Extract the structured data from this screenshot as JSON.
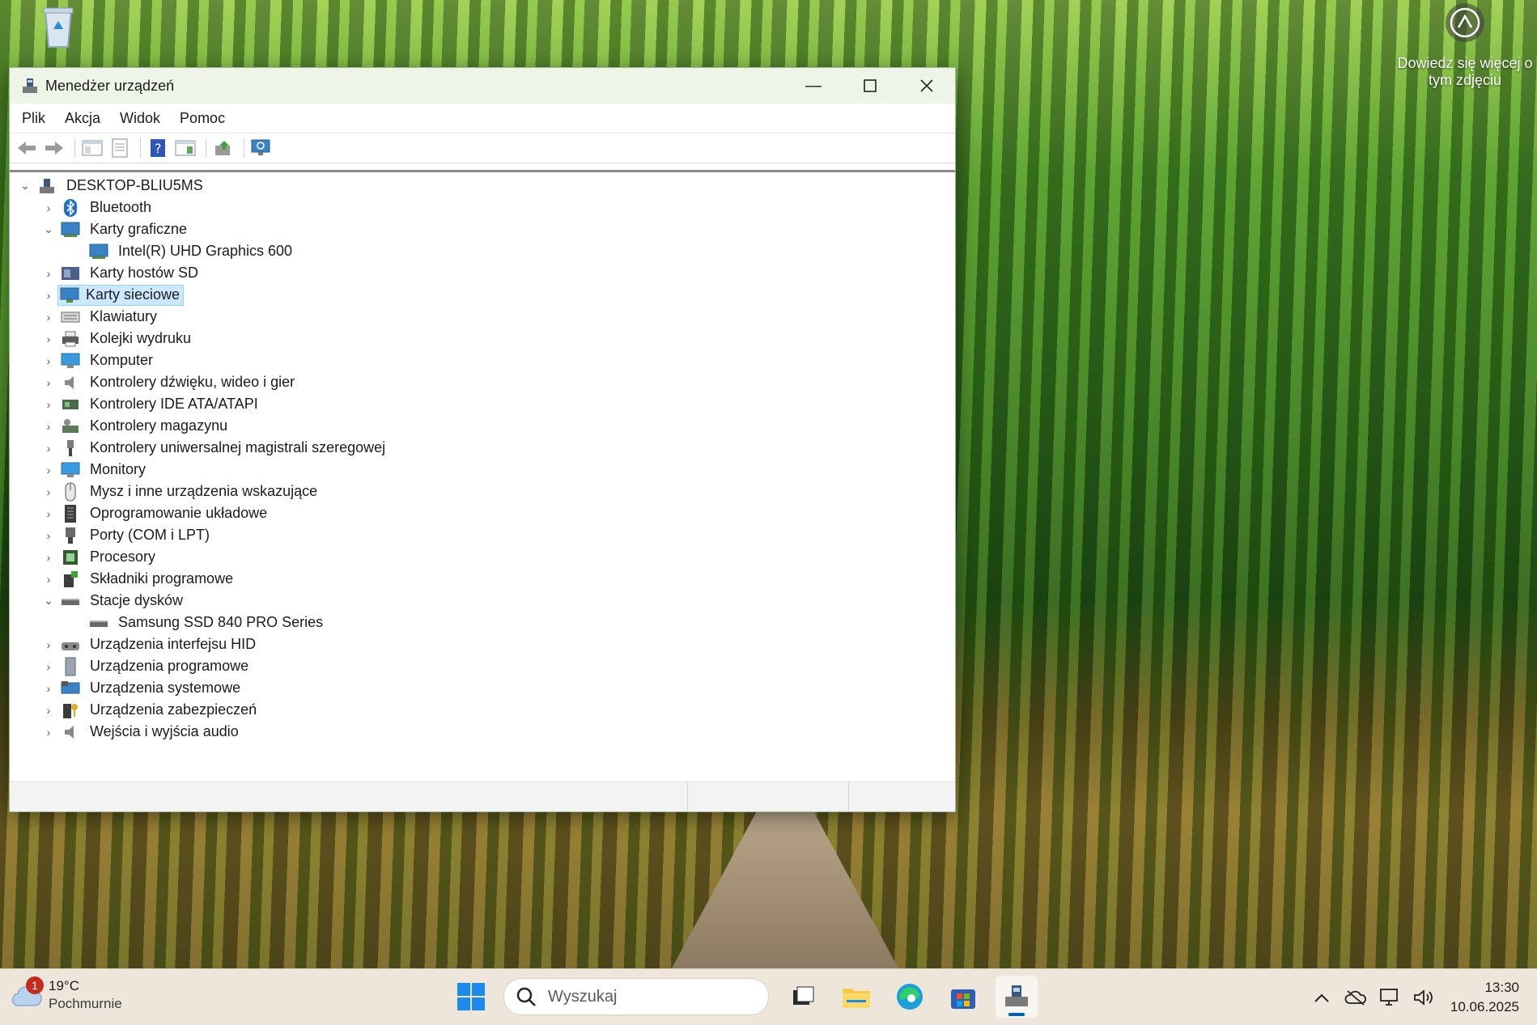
{
  "desktop": {
    "photo_info_text": "Dowiedz się więcej o tym zdjęciu"
  },
  "window": {
    "title": "Menedżer urządzeń",
    "menu": [
      "Plik",
      "Akcja",
      "Widok",
      "Pomoc"
    ],
    "toolbar_icons": [
      "back-arrow-icon",
      "forward-arrow-icon",
      "show-hide-console-tree-icon",
      "properties-icon",
      "help-icon",
      "action-pane-icon",
      "update-driver-icon",
      "scan-hardware-icon"
    ],
    "tree": {
      "root": "DESKTOP-BLIU5MS",
      "items": [
        {
          "label": "Bluetooth",
          "expanded": false,
          "icon": "bluetooth-icon"
        },
        {
          "label": "Karty graficzne",
          "expanded": true,
          "icon": "display-adapter-icon",
          "children": [
            "Intel(R) UHD Graphics 600"
          ]
        },
        {
          "label": "Karty hostów SD",
          "expanded": false,
          "icon": "sd-host-icon"
        },
        {
          "label": "Karty sieciowe",
          "expanded": false,
          "icon": "network-adapter-icon",
          "selected": true
        },
        {
          "label": "Klawiatury",
          "expanded": false,
          "icon": "keyboard-icon"
        },
        {
          "label": "Kolejki wydruku",
          "expanded": false,
          "icon": "printer-icon"
        },
        {
          "label": "Komputer",
          "expanded": false,
          "icon": "computer-icon"
        },
        {
          "label": "Kontrolery dźwięku, wideo i gier",
          "expanded": false,
          "icon": "speaker-icon"
        },
        {
          "label": "Kontrolery IDE ATA/ATAPI",
          "expanded": false,
          "icon": "ide-controller-icon"
        },
        {
          "label": "Kontrolery magazynu",
          "expanded": false,
          "icon": "storage-controller-icon"
        },
        {
          "label": "Kontrolery uniwersalnej magistrali szeregowej",
          "expanded": false,
          "icon": "usb-icon"
        },
        {
          "label": "Monitory",
          "expanded": false,
          "icon": "monitor-icon"
        },
        {
          "label": "Mysz i inne urządzenia wskazujące",
          "expanded": false,
          "icon": "mouse-icon"
        },
        {
          "label": "Oprogramowanie układowe",
          "expanded": false,
          "icon": "firmware-icon"
        },
        {
          "label": "Porty (COM i LPT)",
          "expanded": false,
          "icon": "port-icon"
        },
        {
          "label": "Procesory",
          "expanded": false,
          "icon": "processor-icon"
        },
        {
          "label": "Składniki programowe",
          "expanded": false,
          "icon": "software-component-icon"
        },
        {
          "label": "Stacje dysków",
          "expanded": true,
          "icon": "disk-drive-icon",
          "children": [
            "Samsung SSD 840 PRO Series"
          ]
        },
        {
          "label": "Urządzenia interfejsu HID",
          "expanded": false,
          "icon": "hid-icon"
        },
        {
          "label": "Urządzenia programowe",
          "expanded": false,
          "icon": "software-device-icon"
        },
        {
          "label": "Urządzenia systemowe",
          "expanded": false,
          "icon": "system-device-icon"
        },
        {
          "label": "Urządzenia zabezpieczeń",
          "expanded": false,
          "icon": "security-device-icon"
        },
        {
          "label": "Wejścia i wyjścia audio",
          "expanded": false,
          "icon": "audio-io-icon"
        }
      ]
    }
  },
  "taskbar": {
    "weather": {
      "badge": "1",
      "temp": "19°C",
      "desc": "Pochmurnie"
    },
    "search_placeholder": "Wyszukaj",
    "apps": [
      "task-view-icon",
      "file-explorer-icon",
      "edge-icon",
      "store-icon",
      "device-manager-icon"
    ],
    "tray_icons": [
      "chevron-up-icon",
      "onedrive-icon",
      "network-icon",
      "volume-icon"
    ],
    "time": "13:30",
    "date": "10.06.2025"
  },
  "colors": {
    "selection_bg": "#cce8ff",
    "selection_border": "#99d1ff",
    "titlebar_bg": "#eef5e6",
    "taskbar_bg": "#eee6da",
    "accent": "#005fb8"
  }
}
